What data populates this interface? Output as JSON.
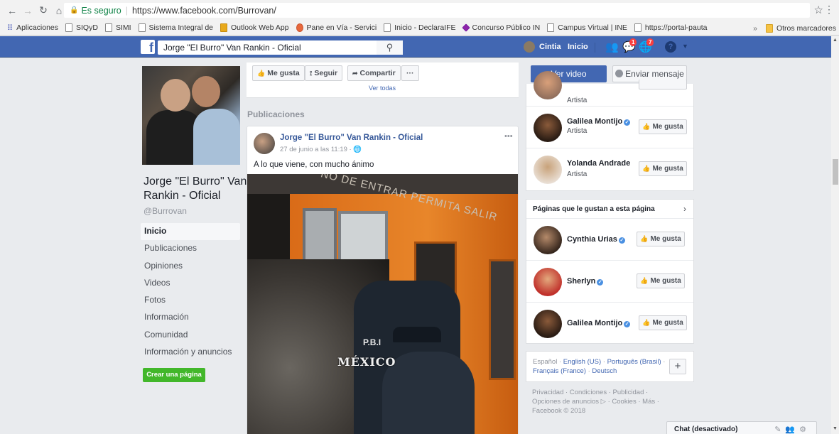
{
  "browser": {
    "secure_label": "Es seguro",
    "url": "https://www.facebook.com/Burrovan/",
    "bookmarks": [
      "Aplicaciones",
      "SIQyD",
      "SIMI",
      "Sistema Integral de",
      "Outlook Web App",
      "Pane en Vía - Servici",
      "Inicio - DeclaraIFE",
      "Concurso Público IN",
      "Campus Virtual | INE",
      "https://portal-pauta"
    ],
    "more_bookmarks": "»",
    "other_bookmarks": "Otros marcadores"
  },
  "fbbar": {
    "search_value": "Jorge \"El Burro\" Van Rankin - Oficial",
    "user": "Cintia",
    "home": "Inicio",
    "friend_badge": "",
    "msg_badge": "1",
    "notif_badge": "7"
  },
  "page": {
    "name": "Jorge \"El Burro\" Van Rankin - Oficial",
    "handle": "@Burrovan",
    "nav": [
      "Inicio",
      "Publicaciones",
      "Opiniones",
      "Videos",
      "Fotos",
      "Información",
      "Comunidad",
      "Información y anuncios"
    ],
    "create_page": "Crear una página"
  },
  "actions": {
    "like": "Me gusta",
    "follow": "Seguir",
    "share": "Compartir",
    "more": "···",
    "see_all": "Ver todas",
    "watch_video": "Ver video",
    "send_message": "Enviar mensaje"
  },
  "publications_header": "Publicaciones",
  "post": {
    "author": "Jorge \"El Burro\" Van Rankin - Oficial",
    "date": "27 de junio a las 11:19 · ",
    "text": "A lo que viene, con mucho ánimo",
    "photo_sign": "NO DE ENTRAR PERMITA SALIR",
    "photo_pbi": "P.B.I",
    "photo_country": "MÉXICO"
  },
  "related_pages": [
    {
      "name": "",
      "sub": "Artista"
    },
    {
      "name": "Galilea Montijo",
      "sub": "Artista",
      "verified": true
    },
    {
      "name": "Yolanda Andrade",
      "sub": "Artista",
      "verified": false
    }
  ],
  "liked_pages": {
    "header": "Páginas que le gustan a esta página",
    "items": [
      {
        "name": "Cynthia Urias"
      },
      {
        "name": "Sherlyn"
      },
      {
        "name": "Galilea Montijo"
      }
    ]
  },
  "like_label": "Me gusta",
  "languages": {
    "current": "Español",
    "others": [
      "English (US)",
      "Português (Brasil)",
      "Français (France)",
      "Deutsch"
    ]
  },
  "footer": {
    "line1": "Privacidad · Condiciones · Publicidad ·",
    "line2": "Opciones de anuncios ▷ · Cookies · Más ·",
    "line3": "Facebook © 2018"
  },
  "chat": {
    "label": "Chat (desactivado)"
  }
}
